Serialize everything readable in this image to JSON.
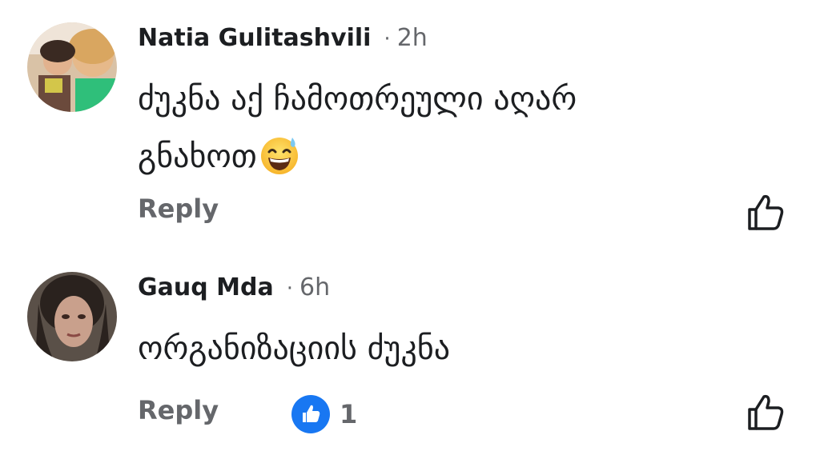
{
  "comments": [
    {
      "author": "Natia Gulitashvili",
      "separator": "·",
      "time": "2h",
      "text_line1": "ძუკნა აქ ჩამოთრეული აღარ",
      "text_line2": "გნახოთ",
      "emoji": "grinning-face-with-sweat",
      "reply_label": "Reply",
      "reactions": null
    },
    {
      "author": "Gauq Mda",
      "separator": "·",
      "time": "6h",
      "text_line1": "ორგანიზაციის ძუკნა",
      "reply_label": "Reply",
      "reactions": {
        "type": "like",
        "count": "1"
      }
    }
  ],
  "colors": {
    "text_primary": "#1c1e21",
    "text_secondary": "#65676b",
    "like_blue": "#1877f2"
  }
}
